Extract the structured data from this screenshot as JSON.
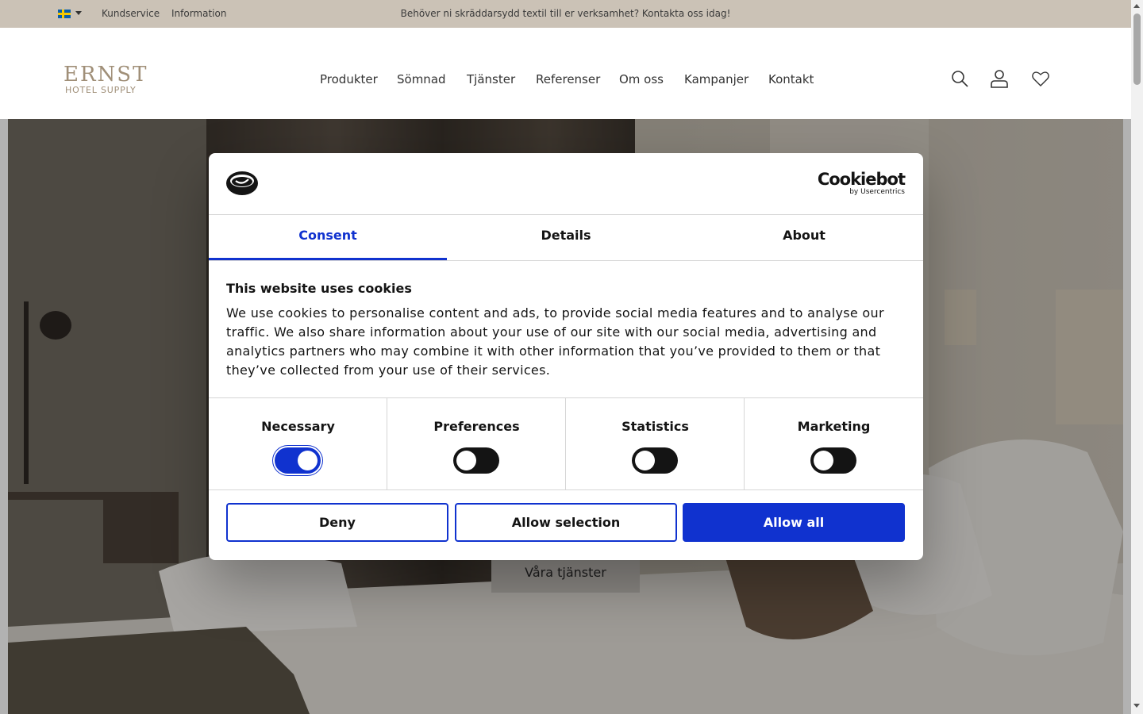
{
  "topbar": {
    "language_icon": "swedish-flag-icon",
    "links": [
      "Kundservice",
      "Information"
    ],
    "promo": "Behöver ni skräddarsydd textil till er verksamhet? Kontakta oss idag!"
  },
  "header": {
    "logo_main": "ERNST",
    "logo_sub": "HOTEL SUPPLY",
    "nav": [
      "Produkter",
      "Sömnad",
      "Tjänster",
      "Referenser",
      "Om oss",
      "Kampanjer",
      "Kontakt"
    ],
    "icons": [
      "search-icon",
      "account-icon",
      "wishlist-heart-icon"
    ]
  },
  "hero": {
    "button": "Våra tjänster"
  },
  "cookie_dialog": {
    "brand": "Cookiebot",
    "brand_sub": "by Usercentrics",
    "tabs": [
      "Consent",
      "Details",
      "About"
    ],
    "active_tab": "Consent",
    "title": "This website uses cookies",
    "text": "We use cookies to personalise content and ads, to provide social media features and to analyse our traffic. We also share information about your use of our site with our social media, advertising and analytics partners who may combine it with other information that you’ve provided to them or that they’ve collected from your use of their services.",
    "toggles": [
      {
        "label": "Necessary",
        "on": true
      },
      {
        "label": "Preferences",
        "on": false
      },
      {
        "label": "Statistics",
        "on": false
      },
      {
        "label": "Marketing",
        "on": false
      }
    ],
    "buttons": {
      "deny": "Deny",
      "allow_selection": "Allow selection",
      "allow_all": "Allow all"
    }
  },
  "colors": {
    "accent": "#1032cf",
    "topbar": "#cbc2b6",
    "logo": "#a08f78"
  }
}
